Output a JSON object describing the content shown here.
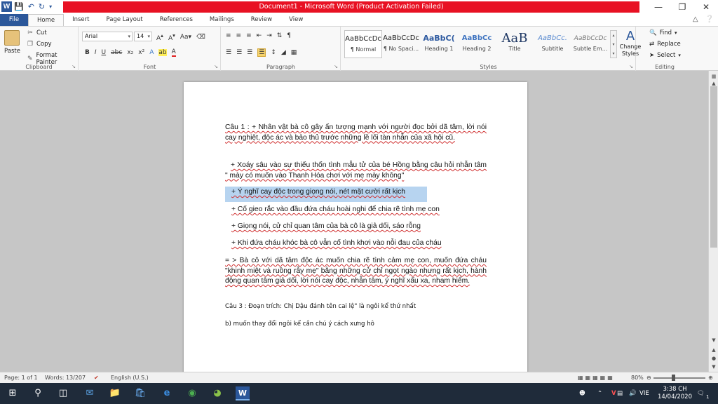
{
  "window": {
    "title": "Document1  -  Microsoft Word (Product Activation Failed)",
    "app_icon": "W",
    "minimize": "—",
    "maximize": "❐",
    "close": "✕"
  },
  "tabs": [
    "File",
    "Home",
    "Insert",
    "Page Layout",
    "References",
    "Mailings",
    "Review",
    "View"
  ],
  "ribbon": {
    "clipboard": {
      "paste": "Paste",
      "cut": "Cut",
      "copy": "Copy",
      "format_painter": "Format Painter",
      "label": "Clipboard"
    },
    "font": {
      "name": "Arial",
      "size": "14",
      "label": "Font"
    },
    "paragraph": {
      "label": "Paragraph"
    },
    "styles": {
      "label": "Styles",
      "items": [
        {
          "sample": "AaBbCcDc",
          "name": "¶ Normal"
        },
        {
          "sample": "AaBbCcDc",
          "name": "¶ No Spaci..."
        },
        {
          "sample": "AaBbC(",
          "name": "Heading 1"
        },
        {
          "sample": "AaBbCc",
          "name": "Heading 2"
        },
        {
          "sample": "AaB",
          "name": "Title"
        },
        {
          "sample": "AaBbCc.",
          "name": "Subtitle"
        },
        {
          "sample": "AaBbCcDc",
          "name": "Subtle Em..."
        }
      ],
      "change_styles": "Change Styles"
    },
    "editing": {
      "find": "Find",
      "replace": "Replace",
      "select": "Select",
      "label": "Editing"
    }
  },
  "document": {
    "p1": "Câu 1 : + Nhân vật bà cô gây ấn tượng mạnh với người đọc bởi dã tâm, lời nói cay nghiệt, độc ác và bảo thủ trước những lề lối tàn nhẫn của xã hội cũ.",
    "p2": "+ Xoáy sâu vào sự thiếu thốn tình mẫu tử của bé Hồng bằng câu hỏi nhẫn tâm \" mày có muốn vào Thanh Hóa chơi với mẹ mày không\"",
    "p3": "+ Ý nghĩ cay độc trong giọng nói, nét mặt cười rất kịch",
    "p4": "+ Cố gieo rắc vào đầu đứa cháu hoài nghi để chia rẽ tình mẹ con",
    "p5": "+ Giọng nói, cử chỉ quan tâm của bà cô là giả dối, sáo rỗng",
    "p6": "+ Khi đứa cháu khóc bà cô vẫn cố tình khơi vào nỗi đau của cháu",
    "p7": "= > Bà cô với dã tâm độc ác muốn chia rẽ tình cảm mẹ con, muốn đứa cháu \"khinh miệt và ruồng rẫy mẹ\" bằng những cử chỉ ngọt ngào nhưng rất kịch, hành động quan tâm giả dối, lời nói cay độc, nhẫn tâm, ý nghĩ xấu xa, nham hiểm.",
    "p8": "Câu 3 : Đoạn trích: Chị Dậu đánh tên cai lệ\" là ngôi kể thứ nhất",
    "p9": "b) muốn thay đổi ngôi kể cần chú ý cách xưng hô"
  },
  "status": {
    "page": "Page: 1 of 1",
    "words": "Words: 13/207",
    "language": "English (U.S.)",
    "zoom": "80%"
  },
  "taskbar": {
    "lang": "VIE",
    "time": "3:38 CH",
    "date": "14/04/2020",
    "notif_count": "1"
  },
  "colors": {
    "word_blue": "#2b579a",
    "title_red": "#e81123",
    "selection": "#b7d4f0",
    "taskbar": "#1f2b3a"
  }
}
